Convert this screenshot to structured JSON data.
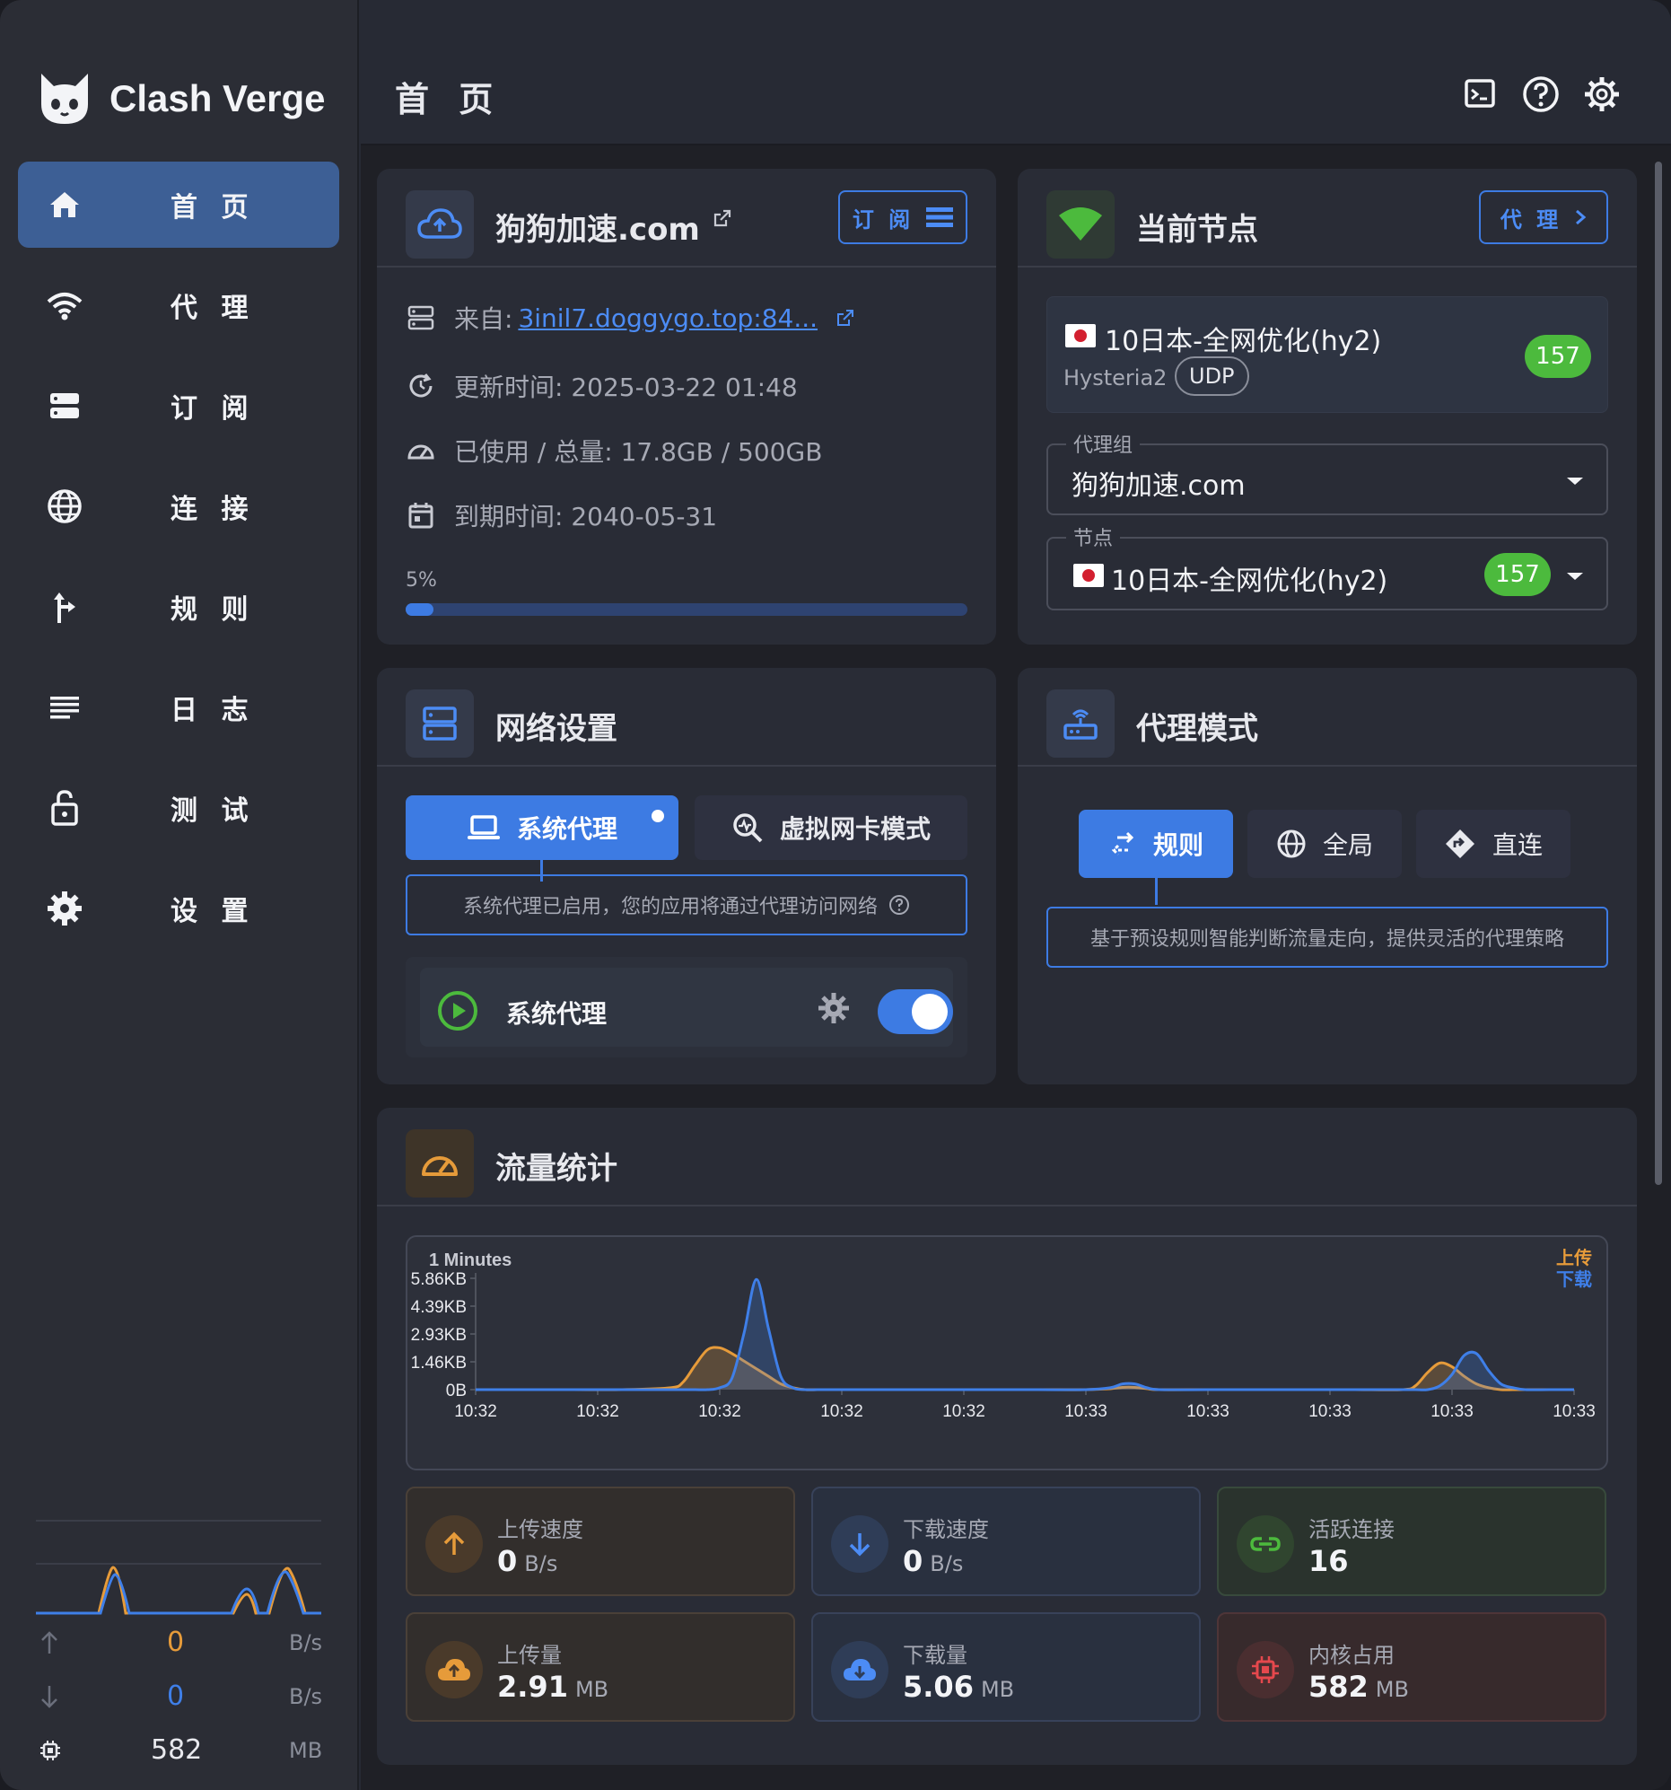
{
  "app": {
    "brand": "Clash Verge",
    "page_title": "首 页"
  },
  "sidebar": {
    "items": [
      {
        "label": "首 页",
        "icon": "home-icon",
        "active": true
      },
      {
        "label": "代 理",
        "icon": "wifi-icon"
      },
      {
        "label": "订 阅",
        "icon": "storage-icon"
      },
      {
        "label": "连 接",
        "icon": "globe-icon"
      },
      {
        "label": "规 则",
        "icon": "fork-icon"
      },
      {
        "label": "日 志",
        "icon": "list-icon"
      },
      {
        "label": "测 试",
        "icon": "lock-icon"
      },
      {
        "label": "设 置",
        "icon": "gear-icon"
      }
    ],
    "upload_rate": "0",
    "upload_unit": "B/s",
    "download_rate": "0",
    "download_unit": "B/s",
    "memory": "582",
    "memory_unit": "MB"
  },
  "profile": {
    "name": "狗狗加速.com",
    "subscribe_button": "订 阅",
    "source_label": "来自:",
    "source_url": "3inil7.doggygo.top:84...",
    "updated": "更新时间: 2025-03-22 01:48",
    "usage": "已使用 / 总量: 17.8GB / 500GB",
    "expire": "到期时间: 2040-05-31",
    "progress_label": "5%",
    "progress": 0.05
  },
  "current_node": {
    "title": "当前节点",
    "proxy_button": "代 理",
    "node_name": "10日本-全网优化(hy2)",
    "protocol": "Hysteria2",
    "transport": "UDP",
    "latency": "157",
    "group_label": "代理组",
    "group_value": "狗狗加速.com",
    "node_label": "节点",
    "node_value": "10日本-全网优化(hy2)",
    "node_latency": "157"
  },
  "network": {
    "title": "网络设置",
    "tab_system": "系统代理",
    "tab_tun": "虚拟网卡模式",
    "hint": "系统代理已启用，您的应用将通过代理访问网络",
    "toggle_label": "系统代理",
    "toggle_on": true
  },
  "mode": {
    "title": "代理模式",
    "rule": "规则",
    "global": "全局",
    "direct": "直连",
    "hint": "基于预设规则智能判断流量走向，提供灵活的代理策略"
  },
  "traffic": {
    "title": "流量统计",
    "stats": [
      {
        "label": "上传速度",
        "value": "0",
        "unit": "B/s"
      },
      {
        "label": "下载速度",
        "value": "0",
        "unit": "B/s"
      },
      {
        "label": "活跃连接",
        "value": "16",
        "unit": ""
      },
      {
        "label": "上传量",
        "value": "2.91",
        "unit": "MB"
      },
      {
        "label": "下载量",
        "value": "5.06",
        "unit": "MB"
      },
      {
        "label": "内核占用",
        "value": "582",
        "unit": "MB"
      }
    ]
  },
  "chart_data": {
    "type": "area",
    "title": "1 Minutes",
    "y_ticks": [
      "5.86KB",
      "4.39KB",
      "2.93KB",
      "1.46KB",
      "0B"
    ],
    "x_ticks": [
      "10:32",
      "10:32",
      "10:32",
      "10:32",
      "10:32",
      "10:33",
      "10:33",
      "10:33",
      "10:33",
      "10:33"
    ],
    "ylim": [
      0,
      5.86
    ],
    "y_unit": "KB",
    "legend": [
      "上传",
      "下载"
    ],
    "legend_position": "top-right",
    "colors": {
      "upload": "#e69b3a",
      "download": "#3f7fe8"
    },
    "x": [
      0,
      4,
      8,
      12,
      16,
      17,
      18,
      19,
      20,
      21,
      22,
      23,
      24,
      25,
      26,
      27,
      28,
      29,
      30,
      32,
      34,
      38,
      42,
      46,
      50,
      52,
      53,
      54,
      55,
      56,
      60,
      64,
      68,
      72,
      76,
      77,
      78,
      79,
      80,
      81,
      82,
      83,
      84,
      85,
      86,
      88,
      90
    ],
    "series": [
      {
        "name": "上传",
        "values": [
          0,
          0,
          0,
          0,
          0.1,
          0.4,
          1.3,
          2.1,
          2.2,
          1.9,
          1.5,
          1.1,
          0.7,
          0.3,
          0.1,
          0,
          0,
          0,
          0,
          0,
          0,
          0,
          0,
          0,
          0,
          0.05,
          0.12,
          0.12,
          0.05,
          0,
          0,
          0,
          0,
          0,
          0,
          0.2,
          0.9,
          1.4,
          1.2,
          0.7,
          0.3,
          0.1,
          0,
          0,
          0,
          0,
          0
        ]
      },
      {
        "name": "下载",
        "values": [
          0,
          0,
          0,
          0,
          0,
          0,
          0,
          0,
          0.1,
          0.6,
          3.0,
          5.8,
          3.2,
          0.7,
          0.1,
          0,
          0,
          0,
          0,
          0,
          0,
          0,
          0,
          0,
          0,
          0.1,
          0.3,
          0.3,
          0.1,
          0,
          0,
          0,
          0,
          0,
          0,
          0,
          0,
          0.2,
          0.8,
          1.8,
          1.9,
          1.0,
          0.3,
          0.1,
          0,
          0,
          0
        ]
      }
    ]
  },
  "colors": {
    "accent": "#3d7be3",
    "active_nav": "#3d5f95",
    "green": "#4cba3d",
    "orange": "#e69b3a"
  }
}
